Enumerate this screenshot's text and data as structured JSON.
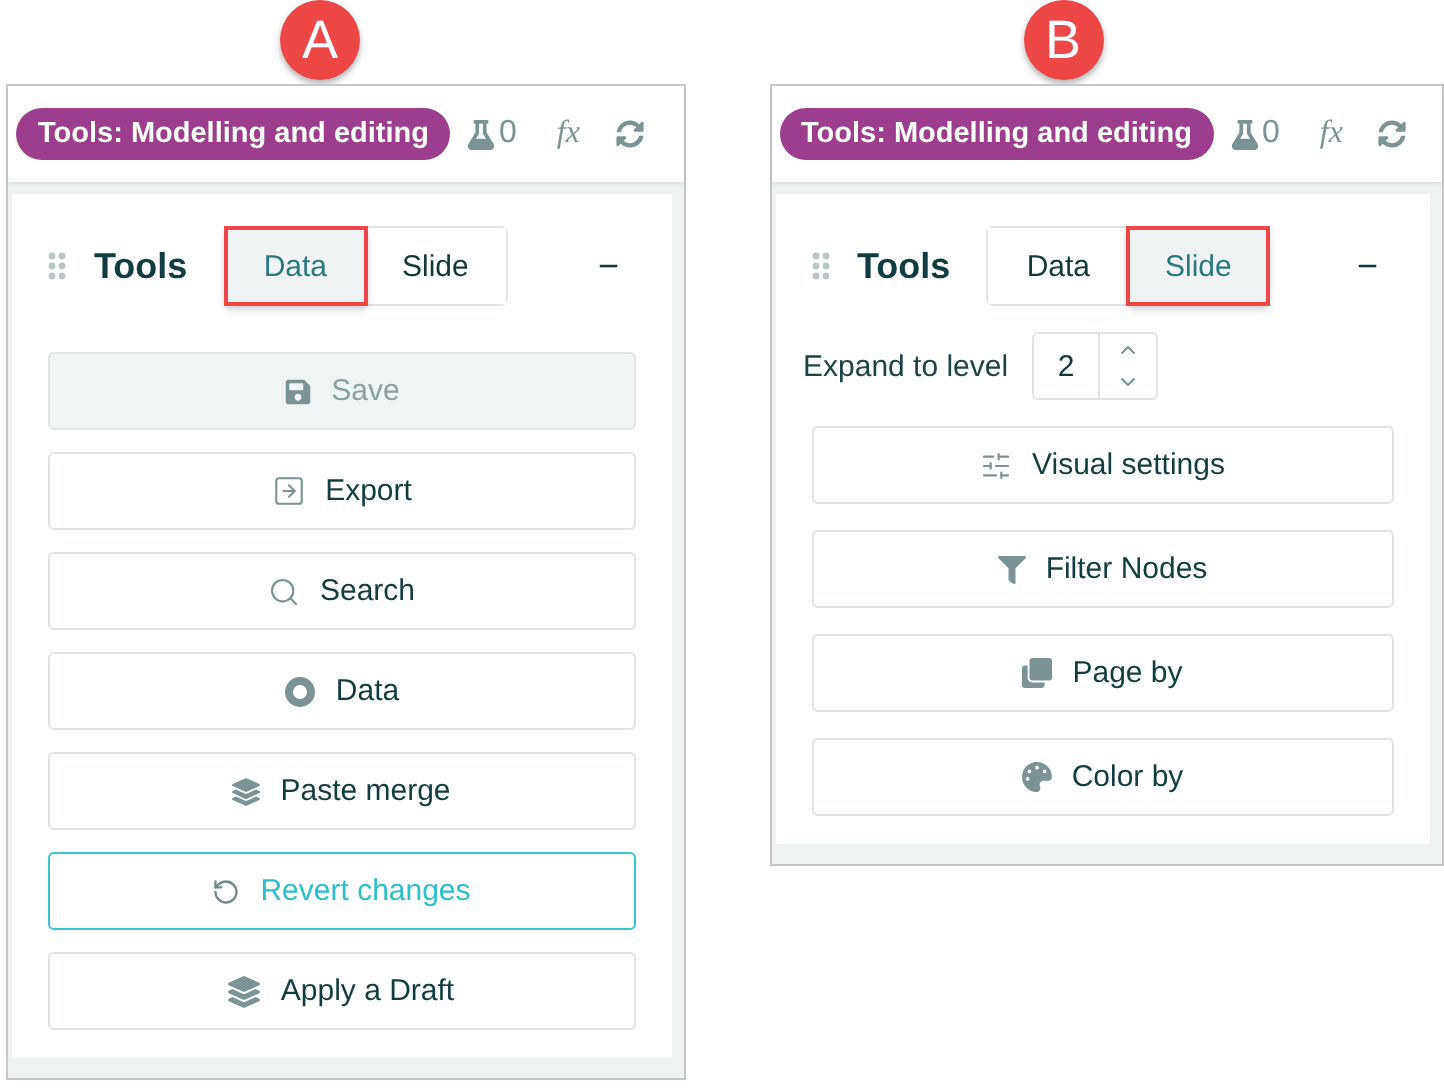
{
  "panels": [
    {
      "badge": "A",
      "pill": "Tools: Modelling and editing",
      "flask_count": "0",
      "fx": "fx",
      "title": "Tools",
      "collapse": "−",
      "tabs": [
        {
          "label": "Data",
          "selected": true,
          "highlighted": true
        },
        {
          "label": "Slide",
          "selected": false,
          "highlighted": false
        }
      ],
      "buttons": [
        {
          "label": "Save",
          "kind": "save",
          "disabled": true,
          "accent": false
        },
        {
          "label": "Export",
          "kind": "export",
          "disabled": false,
          "accent": false
        },
        {
          "label": "Search",
          "kind": "search",
          "disabled": false,
          "accent": false
        },
        {
          "label": "Data",
          "kind": "ring",
          "disabled": false,
          "accent": false
        },
        {
          "label": "Paste merge",
          "kind": "layers",
          "disabled": false,
          "accent": false
        },
        {
          "label": "Revert changes",
          "kind": "revert",
          "disabled": false,
          "accent": true
        },
        {
          "label": "Apply a Draft",
          "kind": "stack",
          "disabled": false,
          "accent": false
        }
      ]
    },
    {
      "badge": "B",
      "pill": "Tools: Modelling and editing",
      "flask_count": "0",
      "fx": "fx",
      "title": "Tools",
      "collapse": "−",
      "tabs": [
        {
          "label": "Data",
          "selected": false,
          "highlighted": false
        },
        {
          "label": "Slide",
          "selected": true,
          "highlighted": true
        }
      ],
      "expand": {
        "label": "Expand to level",
        "value": "2"
      },
      "buttons": [
        {
          "label": "Visual settings",
          "kind": "sliders",
          "disabled": false,
          "accent": false
        },
        {
          "label": "Filter Nodes",
          "kind": "filter",
          "disabled": false,
          "accent": false
        },
        {
          "label": "Page by",
          "kind": "pages",
          "disabled": false,
          "accent": false
        },
        {
          "label": "Color by",
          "kind": "palette",
          "disabled": false,
          "accent": false
        }
      ]
    }
  ]
}
